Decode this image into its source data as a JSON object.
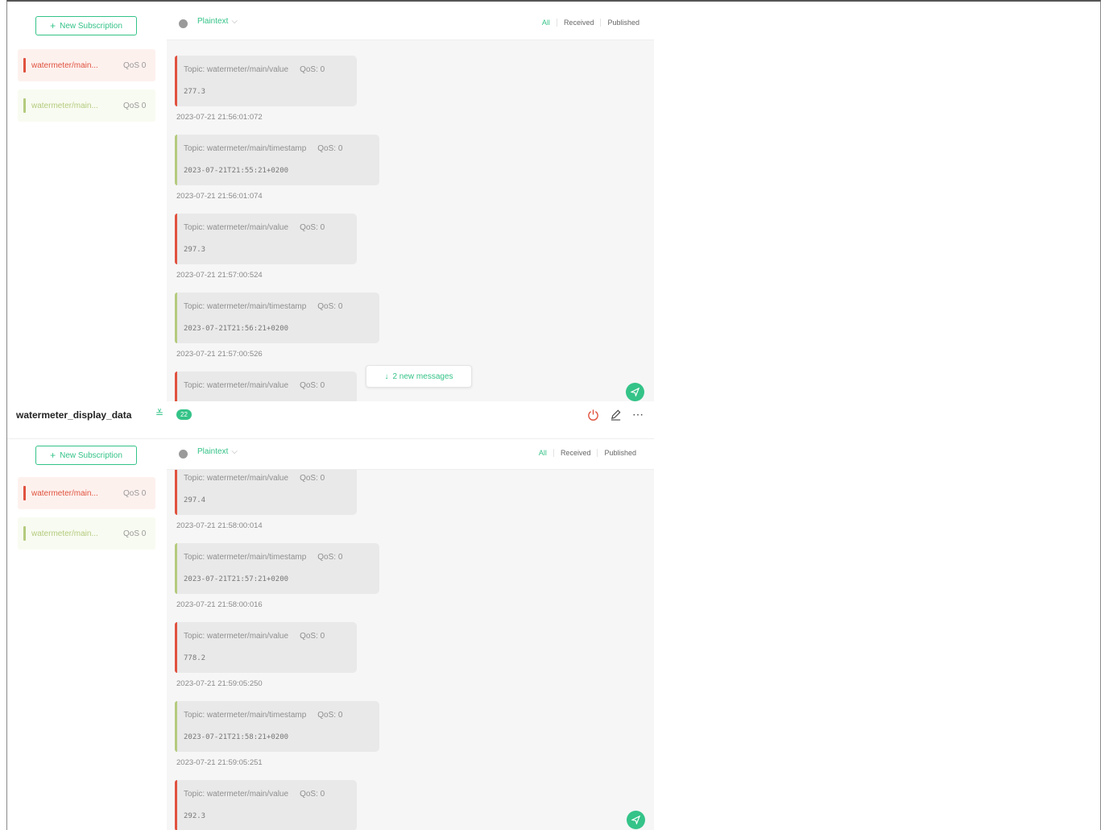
{
  "colors": {
    "accent": "#34c388",
    "topic_value": "#e0523f",
    "topic_timestamp": "#b4cb7e"
  },
  "top_panel": {
    "new_subscription_label": "New Subscription",
    "subscriptions": [
      {
        "topic": "watermeter/main...",
        "qos": "QoS 0",
        "color": "#e0523f"
      },
      {
        "topic": "watermeter/main...",
        "qos": "QoS 0",
        "color": "#b4cb7e"
      }
    ],
    "toolbar": {
      "payload_type": "Plaintext",
      "filters": [
        "All",
        "Received",
        "Published"
      ]
    },
    "messages": [
      {
        "topic": "Topic: watermeter/main/value",
        "qos": "QoS: 0",
        "payload": "277.3",
        "time": "2023-07-21 21:56:01:072",
        "color": "#e0523f"
      },
      {
        "topic": "Topic: watermeter/main/timestamp",
        "qos": "QoS: 0",
        "payload": "2023-07-21T21:55:21+0200",
        "time": "2023-07-21 21:56:01:074",
        "color": "#b4cb7e"
      },
      {
        "topic": "Topic: watermeter/main/value",
        "qos": "QoS: 0",
        "payload": "297.3",
        "time": "2023-07-21 21:57:00:524",
        "color": "#e0523f"
      },
      {
        "topic": "Topic: watermeter/main/timestamp",
        "qos": "QoS: 0",
        "payload": "2023-07-21T21:56:21+0200",
        "time": "2023-07-21 21:57:00:526",
        "color": "#b4cb7e"
      },
      {
        "topic": "Topic: watermeter/main/value",
        "qos": "QoS: 0",
        "payload": "",
        "time": "",
        "color": "#e0523f"
      }
    ],
    "new_messages_label": "2 new messages",
    "new_messages_icon": "arrow-down-icon"
  },
  "connection": {
    "name": "watermeter_display_data",
    "badge_count": "22",
    "icons": [
      "power-icon",
      "edit-icon",
      "more-icon"
    ]
  },
  "bottom_panel": {
    "new_subscription_label": "New Subscription",
    "subscriptions": [
      {
        "topic": "watermeter/main...",
        "qos": "QoS 0",
        "color": "#e0523f"
      },
      {
        "topic": "watermeter/main...",
        "qos": "QoS 0",
        "color": "#b4cb7e"
      }
    ],
    "toolbar": {
      "payload_type": "Plaintext",
      "filters": [
        "All",
        "Received",
        "Published"
      ]
    },
    "messages": [
      {
        "topic": "Topic: watermeter/main/value",
        "qos": "QoS: 0",
        "payload": "297.4",
        "time": "2023-07-21 21:58:00:014",
        "color": "#e0523f"
      },
      {
        "topic": "Topic: watermeter/main/timestamp",
        "qos": "QoS: 0",
        "payload": "2023-07-21T21:57:21+0200",
        "time": "2023-07-21 21:58:00:016",
        "color": "#b4cb7e"
      },
      {
        "topic": "Topic: watermeter/main/value",
        "qos": "QoS: 0",
        "payload": "778.2",
        "time": "2023-07-21 21:59:05:250",
        "color": "#e0523f"
      },
      {
        "topic": "Topic: watermeter/main/timestamp",
        "qos": "QoS: 0",
        "payload": "2023-07-21T21:58:21+0200",
        "time": "2023-07-21 21:59:05:251",
        "color": "#b4cb7e"
      },
      {
        "topic": "Topic: watermeter/main/value",
        "qos": "QoS: 0",
        "payload": "292.3",
        "time": "",
        "color": "#e0523f"
      }
    ]
  }
}
